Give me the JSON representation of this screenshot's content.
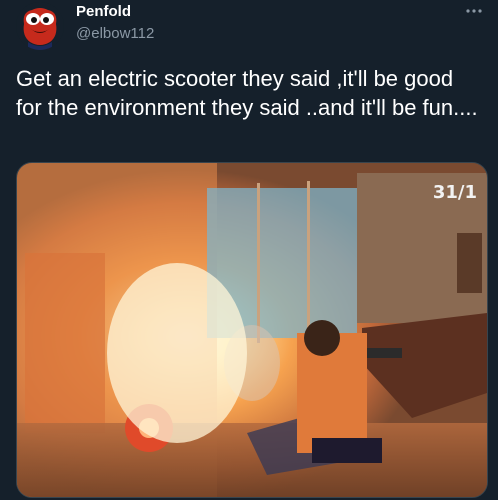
{
  "tweet": {
    "author": {
      "display_name": "Penfold",
      "handle": "@elbow112"
    },
    "more_icon": "more-horizontal-icon",
    "text": "Get an electric scooter they said ,it'll be good for the environment they said ..and it'll be fun....",
    "media": {
      "type": "video-still",
      "timestamp_overlay": "31/1"
    }
  },
  "colors": {
    "background": "#15202b",
    "text": "#ffffff",
    "secondary_text": "#8b98a5",
    "border": "#38444d"
  }
}
